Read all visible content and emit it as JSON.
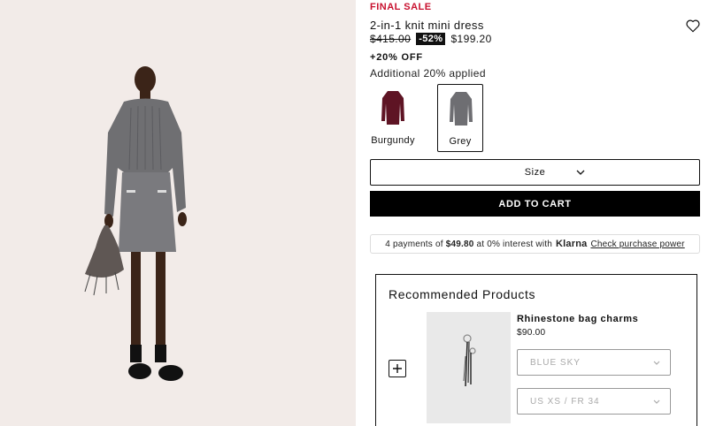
{
  "product": {
    "badge": "FINAL SALE",
    "title": "2-in-1 knit mini dress",
    "original_price": "$415.00",
    "discount_badge": "-52%",
    "sale_price": "$199.20",
    "extra_off": "+20% OFF",
    "extra_note": "Additional 20% applied",
    "wishlist_icon": "heart-icon"
  },
  "colors": [
    {
      "label": "Burgundy",
      "hex": "#5e1424",
      "selected": false
    },
    {
      "label": "Grey",
      "hex": "#6e6e72",
      "selected": true
    }
  ],
  "size_select": {
    "label": "Size"
  },
  "add_to_cart": {
    "label": "ADD TO CART"
  },
  "klarna": {
    "prefix": "4 payments of",
    "amount": "$49.80",
    "middle": "at 0% interest with",
    "brand": "Klarna",
    "link": "Check purchase power"
  },
  "recommended": {
    "heading": "Recommended Products",
    "item": {
      "name": "Rhinestone bag charms",
      "price": "$90.00",
      "color_option": "BLUE SKY",
      "size_option": "US XS / FR 34"
    }
  },
  "theme": {
    "sale_red": "#c8102e",
    "button_black": "#000000",
    "photo_bg": "#f2ebe8"
  }
}
